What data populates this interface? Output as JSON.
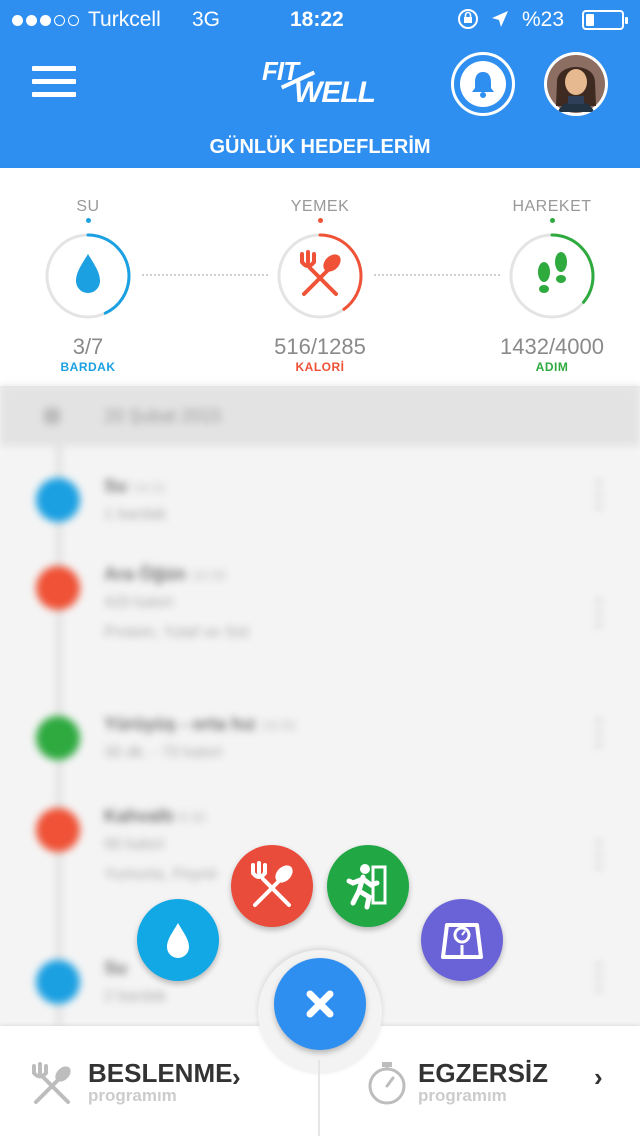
{
  "status_bar": {
    "carrier": "Turkcell",
    "network": "3G",
    "time": "18:22",
    "battery_text": "%23",
    "battery_level": 0.23,
    "signal_bars_filled": 3,
    "signal_bars_total": 5
  },
  "header": {
    "logo_line1": "FIT",
    "logo_line2": "WELL",
    "section_title": "GÜNLÜK HEDEFLERİM"
  },
  "goals": [
    {
      "label": "SU",
      "value": "3/7",
      "unit": "BARDAK",
      "color": "#1ba0e2",
      "progress": 0.43,
      "icon": "water-drop-icon"
    },
    {
      "label": "YEMEK",
      "value": "516/1285",
      "unit": "KALORİ",
      "color": "#ef5236",
      "progress": 0.4,
      "icon": "fork-spoon-icon"
    },
    {
      "label": "HAREKET",
      "value": "1432/4000",
      "unit": "ADIM",
      "color": "#2eaa3f",
      "progress": 0.36,
      "icon": "footsteps-icon"
    }
  ],
  "feed": {
    "date": "20 Şubat 2015",
    "items": [
      {
        "title": "Su",
        "time": "14:11",
        "sub": "1 bardak",
        "sub2": "",
        "color": "#1ba0e2"
      },
      {
        "title": "Ara Öğün",
        "time": "16:30",
        "sub": "420 kalori",
        "sub2": "Protein, Yulaf ve Süt",
        "color": "#ef5236"
      },
      {
        "title": "Yürüyüş - orta hız",
        "time": "16:00",
        "sub": "30 dk. - 70 kalori",
        "sub2": "",
        "color": "#2eaa3f"
      },
      {
        "title": "Kahvaltı",
        "time": "8:30",
        "sub": "90 kalori",
        "sub2": "Yumurta, Peynir",
        "color": "#ef5236"
      },
      {
        "title": "Su",
        "time": "",
        "sub": "2 bardak",
        "sub2": "",
        "color": "#1ba0e2"
      }
    ]
  },
  "fab_menu": {
    "colors": {
      "water": "#12a7e5",
      "food": "#ea4c3c",
      "exercise": "#22a745",
      "weight": "#6a63d8",
      "close": "#2f8ff0"
    }
  },
  "bottom_nav": {
    "nutrition": {
      "title": "BESLENME",
      "sub": "programım"
    },
    "exercise": {
      "title": "EGZERSİZ",
      "sub": "programım"
    }
  }
}
